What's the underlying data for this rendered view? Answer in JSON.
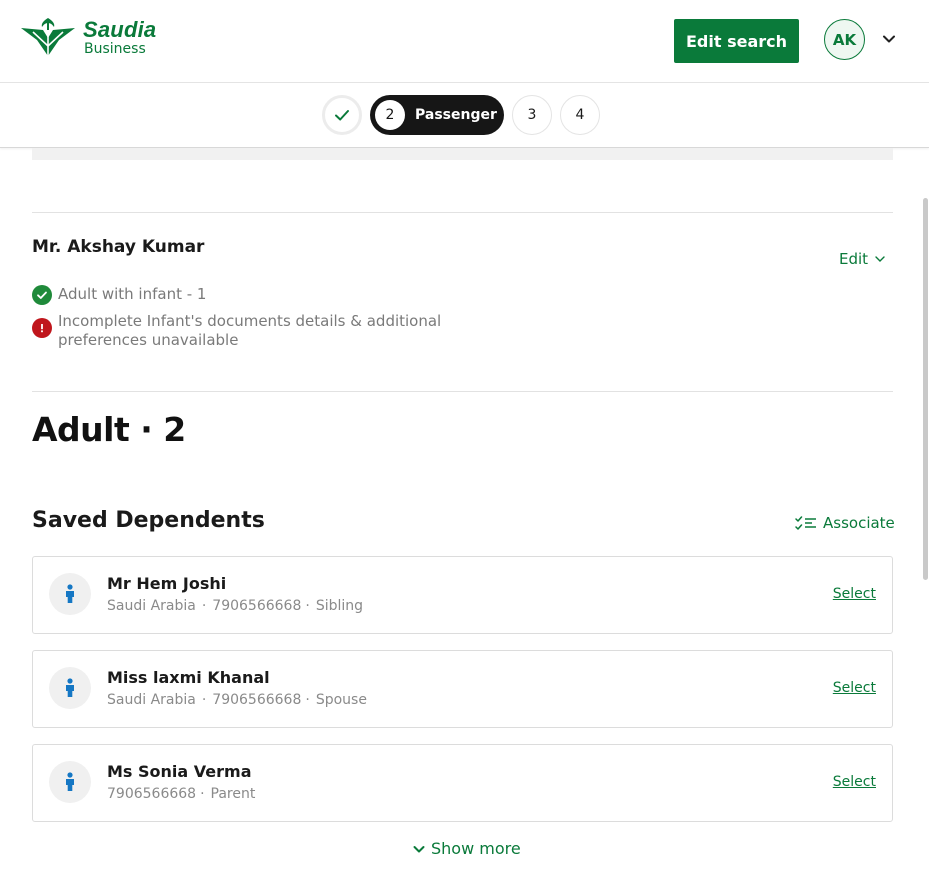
{
  "header": {
    "brand_name": "Saudia",
    "brand_sub": "Business",
    "edit_search_label": "Edit search",
    "avatar_initials": "AK"
  },
  "stepper": {
    "active_number": "2",
    "active_label": "Passenger",
    "step3": "3",
    "step4": "4"
  },
  "passenger_summary": {
    "name": "Mr. Akshay Kumar",
    "edit_label": "Edit",
    "status_ok": "Adult with infant - 1",
    "status_warning": "Incomplete Infant's documents details & additional preferences unavailable"
  },
  "adult_section": {
    "heading": "Adult · 2"
  },
  "saved_dependents": {
    "heading": "Saved Dependents",
    "associate_label": "Associate",
    "select_label": "Select",
    "items": [
      {
        "name": "Mr Hem Joshi",
        "country": "Saudi Arabia",
        "phone": "7906566668",
        "relation": "Sibling"
      },
      {
        "name": "Miss laxmi Khanal",
        "country": "Saudi Arabia",
        "phone": "7906566668",
        "relation": "Spouse"
      },
      {
        "name": "Ms Sonia Verma",
        "phone": "7906566668",
        "relation": "Parent"
      }
    ],
    "show_more_label": "Show more"
  },
  "colors": {
    "brand_green": "#0a7a3a",
    "success_green": "#1f8a3a",
    "error_red": "#c0161c",
    "person_blue": "#1577c4"
  }
}
